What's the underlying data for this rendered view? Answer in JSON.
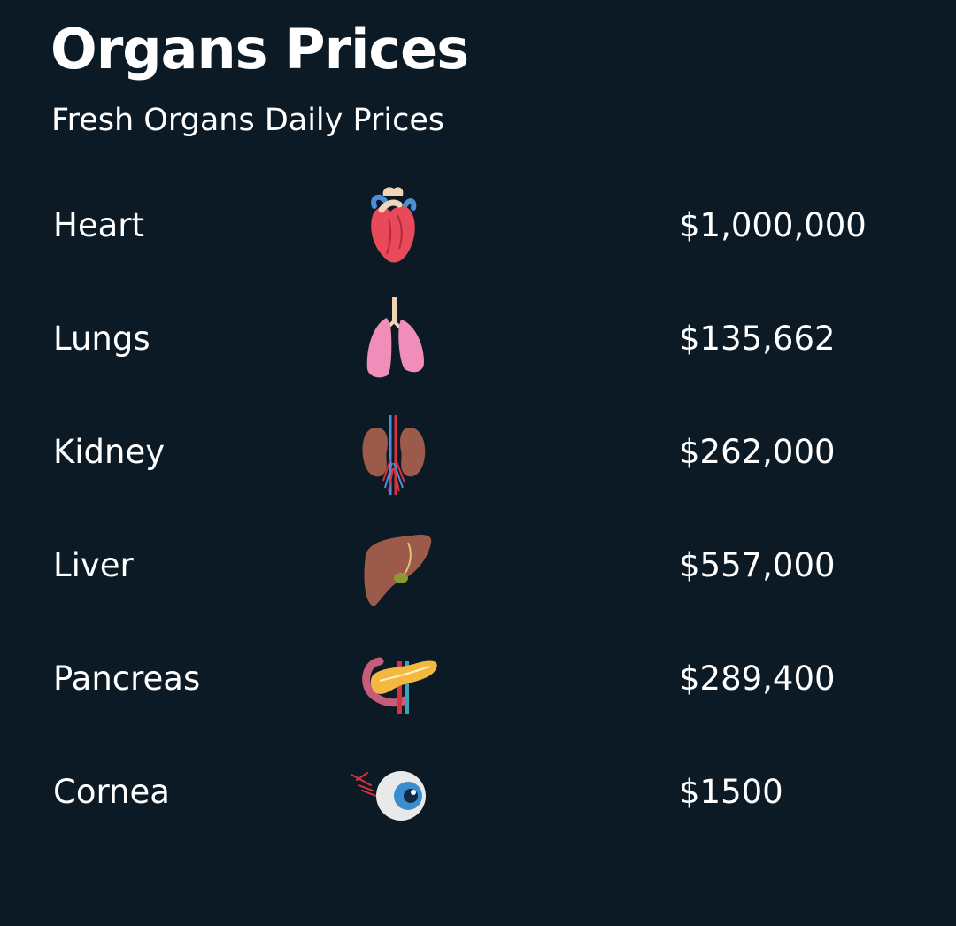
{
  "header": {
    "title": "Organs Prices",
    "subtitle": "Fresh Organs Daily Prices"
  },
  "organs": [
    {
      "name": "Heart",
      "icon": "heart-icon",
      "price": "$1,000,000"
    },
    {
      "name": "Lungs",
      "icon": "lungs-icon",
      "price": "$135,662"
    },
    {
      "name": "Kidney",
      "icon": "kidney-icon",
      "price": "$262,000"
    },
    {
      "name": "Liver",
      "icon": "liver-icon",
      "price": "$557,000"
    },
    {
      "name": "Pancreas",
      "icon": "pancreas-icon",
      "price": "$289,400"
    },
    {
      "name": "Cornea",
      "icon": "eye-icon",
      "price": "$1500"
    }
  ],
  "colors": {
    "background": "#0b1a24",
    "text": "#ffffff"
  }
}
